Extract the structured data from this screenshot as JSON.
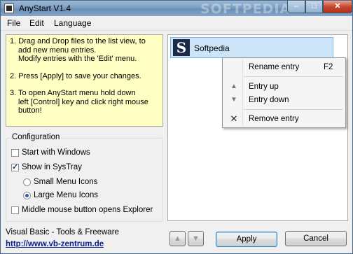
{
  "window": {
    "title": "AnyStart V1.4",
    "watermark": "SOFTPEDIA",
    "controls": {
      "minimize": "–",
      "maximize": "□",
      "close": "✕"
    }
  },
  "menu": {
    "items": [
      "File",
      "Edit",
      "Language"
    ]
  },
  "help": {
    "lines1": [
      "1. Drag and Drop files to the list view, to",
      "add new menu entries.",
      "Modify entries with the 'Edit' menu."
    ],
    "lines2": [
      "2. Press [Apply] to save your changes."
    ],
    "lines3": [
      "3. To open AnyStart menu hold down",
      "left [Control] key and click right mouse",
      "button!"
    ]
  },
  "config": {
    "title": "Configuration",
    "start_with_windows": {
      "label": "Start with Windows",
      "checked": false
    },
    "show_in_systray": {
      "label": "Show in SysTray",
      "checked": true
    },
    "small_icons": {
      "label": "Small Menu Icons",
      "checked": false
    },
    "large_icons": {
      "label": "Large Menu Icons",
      "checked": true
    },
    "middle_mouse": {
      "label": "Middle mouse button opens Explorer",
      "checked": false
    }
  },
  "footer": {
    "company": "Visual Basic - Tools & Freeware",
    "url": "http://www.vb-zentrum.de"
  },
  "list": {
    "entries": [
      {
        "icon_letter": "S",
        "label": "Softpedia"
      }
    ]
  },
  "context_menu": {
    "rename": {
      "label": "Rename entry",
      "shortcut": "F2"
    },
    "up": {
      "label": "Entry up",
      "icon": "arrow-up-icon",
      "glyph": "▲"
    },
    "down": {
      "label": "Entry down",
      "icon": "arrow-down-icon",
      "glyph": "▼"
    },
    "remove": {
      "label": "Remove entry",
      "icon": "close-icon",
      "glyph": "✕"
    }
  },
  "buttons": {
    "up_glyph": "▲",
    "down_glyph": "▼",
    "apply": "Apply",
    "cancel": "Cancel"
  },
  "colors": {
    "help_background": "#ffffc4",
    "selection": "#cce4f7",
    "url": "#0a1e8c"
  }
}
